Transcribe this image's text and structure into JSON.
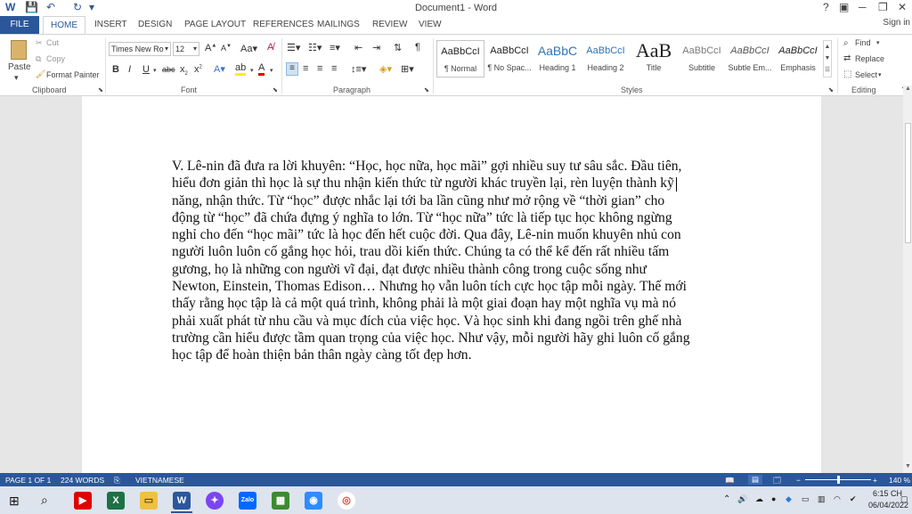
{
  "window": {
    "title": "Document1 - Word",
    "help": "?",
    "minimize": "─",
    "restore": "❐",
    "close": "✕"
  },
  "quick_access": {
    "save": "💾",
    "undo": "↶",
    "redo": "↻",
    "customize": "▾"
  },
  "tabs": [
    "FILE",
    "HOME",
    "INSERT",
    "DESIGN",
    "PAGE LAYOUT",
    "REFERENCES",
    "MAILINGS",
    "REVIEW",
    "VIEW"
  ],
  "signin": "Sign in",
  "clipboard": {
    "paste": "Paste",
    "cut": "Cut",
    "copy": "Copy",
    "format_painter": "Format Painter",
    "group": "Clipboard"
  },
  "font": {
    "name": "Times New Ro",
    "size": "12",
    "group": "Font"
  },
  "paragraph": {
    "group": "Paragraph"
  },
  "styles": {
    "group": "Styles",
    "items": [
      {
        "sample": "AaBbCcI",
        "name": "¶ Normal"
      },
      {
        "sample": "AaBbCcI",
        "name": "¶ No Spac..."
      },
      {
        "sample": "AaBbC",
        "name": "Heading 1"
      },
      {
        "sample": "AaBbCcI",
        "name": "Heading 2"
      },
      {
        "sample": "AaB",
        "name": "Title"
      },
      {
        "sample": "AaBbCcI",
        "name": "Subtitle"
      },
      {
        "sample": "AaBbCcI",
        "name": "Subtle Em..."
      },
      {
        "sample": "AaBbCcI",
        "name": "Emphasis"
      }
    ]
  },
  "editing": {
    "find": "Find",
    "replace": "Replace",
    "select": "Select",
    "group": "Editing"
  },
  "document": {
    "lines": [
      "V. Lê-nin đã đưa ra lời khuyên: “Học, học nữa, học mãi” gợi nhiều suy tư sâu sắc. Đầu tiên,",
      "hiểu đơn giản thì học là sự thu nhận kiến thức từ người khác truyền lại, rèn luyện thành kỹ",
      "năng, nhận thức. Từ “học” được nhắc lại tới ba lần cũng như mở rộng về “thời gian” cho",
      "động từ “học” đã chứa đựng ý nghĩa to lớn. Từ “học nữa” tức là tiếp tục học không ngừng",
      "nghỉ cho đến “học mãi” tức là học đến hết cuộc đời. Qua đây, Lê-nin muốn khuyên nhủ con",
      "người luôn luôn cố gắng học hỏi, trau dồi kiến thức. Chúng ta có thể kể đến rất nhiều tấm",
      "gương, họ là những con người vĩ đại, đạt được nhiều thành công trong cuộc sống như",
      "Newton, Einstein, Thomas Edison… Nhưng họ vẫn luôn tích cực học tập mỗi ngày. Thế mới",
      "thấy rằng học tập là cả một quá trình, không phải là một giai đoạn hay một nghĩa vụ mà nó",
      "phải xuất phát từ nhu cầu và mục đích của việc học. Và học sinh khi đang ngồi trên ghế nhà",
      "trường cần hiểu được tầm quan trọng của việc học. Như vậy, mỗi người hãy ghi luôn cố gắng",
      "học tập để hoàn thiện bản thân ngày càng tốt đẹp hơn."
    ]
  },
  "status": {
    "page": "PAGE 1 OF 1",
    "words": "224 WORDS",
    "language": "VIETNAMESE",
    "zoom": "140 %"
  },
  "taskbar": {
    "apps": [
      "youtube-app",
      "excel-app",
      "file-explorer-app",
      "word-app",
      "messenger-app",
      "zalo-app",
      "zoom-app",
      "app-game",
      "chrome-app"
    ],
    "zalo_label": "Zalo",
    "time": "6:15 CH",
    "date": "06/04/2022"
  }
}
